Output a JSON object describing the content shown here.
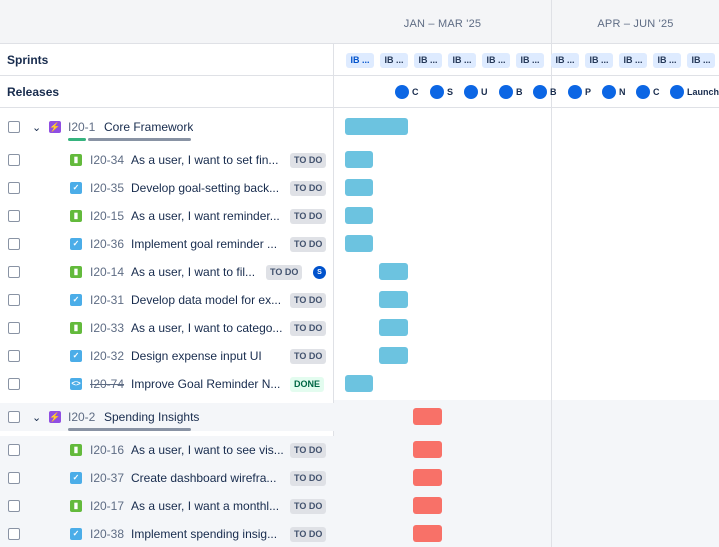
{
  "timeline": {
    "months": [
      "JAN – MAR '25",
      "APR – JUN '25"
    ],
    "sprints_label": "Sprints",
    "releases_label": "Releases",
    "sprints": [
      "IB ...",
      "IB ...",
      "IB ...",
      "IB ...",
      "IB ...",
      "IB ...",
      "IB ...",
      "IB ...",
      "IB ...",
      "IB ...",
      "IB ..."
    ],
    "releases": [
      "C",
      "S",
      "U",
      "B",
      "B",
      "P",
      "N",
      "C",
      "Launch"
    ]
  },
  "epics": [
    {
      "key": "I20-1",
      "summary": "Core Framework",
      "color": "#6cc3e0",
      "issues": [
        {
          "type": "story",
          "key": "I20-34",
          "summary": "As a user, I want to set fin...",
          "status": "TO DO"
        },
        {
          "type": "task",
          "key": "I20-35",
          "summary": "Develop goal-setting back...",
          "status": "TO DO"
        },
        {
          "type": "story",
          "key": "I20-15",
          "summary": "As a user, I want reminder...",
          "status": "TO DO"
        },
        {
          "type": "task",
          "key": "I20-36",
          "summary": "Implement goal reminder ...",
          "status": "TO DO"
        },
        {
          "type": "story",
          "key": "I20-14",
          "summary": "As a user, I want to fil...",
          "status": "TO DO",
          "assignee": "S"
        },
        {
          "type": "task",
          "key": "I20-31",
          "summary": "Develop data model for ex...",
          "status": "TO DO"
        },
        {
          "type": "story",
          "key": "I20-33",
          "summary": "As a user, I want to catego...",
          "status": "TO DO"
        },
        {
          "type": "task",
          "key": "I20-32",
          "summary": "Design expense input UI",
          "status": "TO DO"
        },
        {
          "type": "subtask",
          "key": "I20-74",
          "summary": "Improve Goal Reminder N...",
          "status": "DONE"
        }
      ]
    },
    {
      "key": "I20-2",
      "summary": "Spending Insights",
      "color": "#f87168",
      "issues": [
        {
          "type": "story",
          "key": "I20-16",
          "summary": "As a user, I want to see vis...",
          "status": "TO DO"
        },
        {
          "type": "task",
          "key": "I20-37",
          "summary": "Create dashboard wirefra...",
          "status": "TO DO"
        },
        {
          "type": "story",
          "key": "I20-17",
          "summary": "As a user, I want a monthl...",
          "status": "TO DO"
        },
        {
          "type": "task",
          "key": "I20-38",
          "summary": "Implement spending insig...",
          "status": "TO DO"
        }
      ]
    }
  ],
  "icons": {
    "epic": "lightning-icon",
    "story": "bookmark-icon",
    "task": "checkbox-icon",
    "subtask": "code-icon",
    "expand": "chevron-down-icon"
  }
}
